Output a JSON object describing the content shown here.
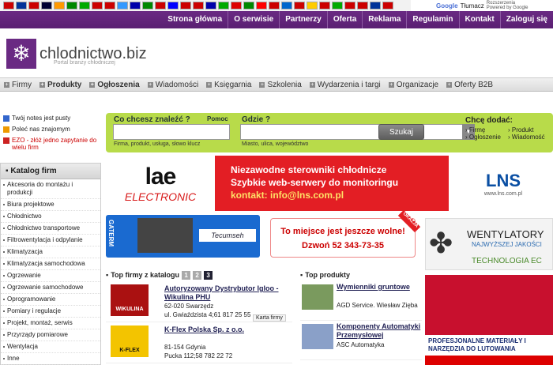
{
  "translate": {
    "brand": "Google",
    "label": "Tłumacz",
    "ext1": "Rozszerzenia",
    "ext2": "Powered by Google"
  },
  "flags": [
    "#c00",
    "#039",
    "#c00",
    "#003",
    "#f90",
    "#080",
    "#0a0",
    "#c00",
    "#c00",
    "#39f",
    "#00a",
    "#080",
    "#c00",
    "#00f",
    "#c00",
    "#c00",
    "#00a",
    "#0a0",
    "#d00",
    "#080",
    "#f00",
    "#c00",
    "#06c",
    "#c00",
    "#fc0",
    "#c00",
    "#0a0",
    "#c00",
    "#c00",
    "#039",
    "#c00"
  ],
  "topnav": [
    "Strona główna",
    "O serwisie",
    "Partnerzy",
    "Oferta",
    "Reklama",
    "Regulamin",
    "Kontakt",
    "Zaloguj się"
  ],
  "logo": {
    "name": "chlodnictwo.biz",
    "sub": "Portal branży chłodniczej"
  },
  "secnav": [
    {
      "label": "Firmy",
      "bold": false
    },
    {
      "label": "Produkty",
      "bold": true
    },
    {
      "label": "Ogłoszenia",
      "bold": true
    },
    {
      "label": "Wiadomości",
      "bold": false
    },
    {
      "label": "Księgarnia",
      "bold": false
    },
    {
      "label": "Szkolenia",
      "bold": false
    },
    {
      "label": "Wydarzenia i targi",
      "bold": false
    },
    {
      "label": "Organizacje",
      "bold": false
    },
    {
      "label": "Oferty B2B",
      "bold": false
    }
  ],
  "left": {
    "notes": "Twój notes jest pusty",
    "recommend": "Poleć nas znajomym",
    "ezo": "EZO - złóż jedno zapytanie do wielu firm"
  },
  "catalog": {
    "title": "Katalog firm",
    "items": [
      "Akcesoria do montażu i produkcji",
      "Biura projektowe",
      "Chłodnictwo",
      "Chłodnictwo transportowe",
      "Filtrowentylacja i odpylanie",
      "Klimatyzacja",
      "Klimatyzacja samochodowa",
      "Ogrzewanie",
      "Ogrzewanie samochodowe",
      "Oprogramowanie",
      "Pomiary i regulacje",
      "Projekt, montaż, serwis",
      "Przyrządy pomiarowe",
      "Wentylacja",
      "Inne"
    ]
  },
  "search": {
    "what_label": "Co chcesz znaleźć ?",
    "help": "Pomoc",
    "what_hint": "Firma, produkt, usługa, słowo klucz",
    "where_label": "Gdzie ?",
    "where_hint": "Miasto, ulica, województwo",
    "button": "Szukaj",
    "add_title": "Chcę dodać:",
    "add_items": [
      "Firmę",
      "Ogłoszenie",
      "Produkt",
      "Wiadomość"
    ]
  },
  "banners": {
    "lae_top": "lae",
    "lae_bottom": "ELECTRONIC",
    "red_line1": "Niezawodne sterowniki chłodnicze",
    "red_line2": "Szybkie web-serwery do monitoringu",
    "red_line3": "kontakt: info@lns.com.pl",
    "lns": "LNS",
    "lns_sub": "www.lns.com.pl",
    "gaterm": "GATERM",
    "tecumseh": "Tecumseh",
    "free1": "To miejsce jest jeszcze wolne!",
    "free2": "Dzwoń 52 343-73-35",
    "okazja": "OKAZJA",
    "went_t": "WENTYLATORY",
    "went_s": "NAJWYŻSZEJ JAKOŚCI",
    "went_e": "TECHNOLOGIA EC",
    "lut": "PROFESJONALNE MATERIAŁY I NARZĘDZIA DO LUTOWANIA"
  },
  "top_firms": {
    "title": "Top firmy z katalogu",
    "pages": [
      "1",
      "2",
      "3"
    ],
    "current": "3",
    "items": [
      {
        "logo": "WIKULINA",
        "name": "Autoryzowany Dystrybutor Igloo - Wikulina PHU",
        "addr1": "62-020 Swarzędz",
        "addr2": "ul. Gwiaździsta 4;61 817 25 55",
        "card": "Karta firmy"
      },
      {
        "logo": "K-FLEX",
        "name": "K-Flex Polska Sp. z o.o.",
        "addr1": "81-154 Gdynia",
        "addr2": "Pucka 112;58 782 22 72",
        "card": ""
      }
    ]
  },
  "top_products": {
    "title": "Top produkty",
    "items": [
      {
        "name": "Wymienniki gruntowe",
        "co": "AGD Service. Wiesław Zięba"
      },
      {
        "name": "Komponenty Automatyki Przemysłowej",
        "co": "ASC Automatyka"
      }
    ]
  }
}
